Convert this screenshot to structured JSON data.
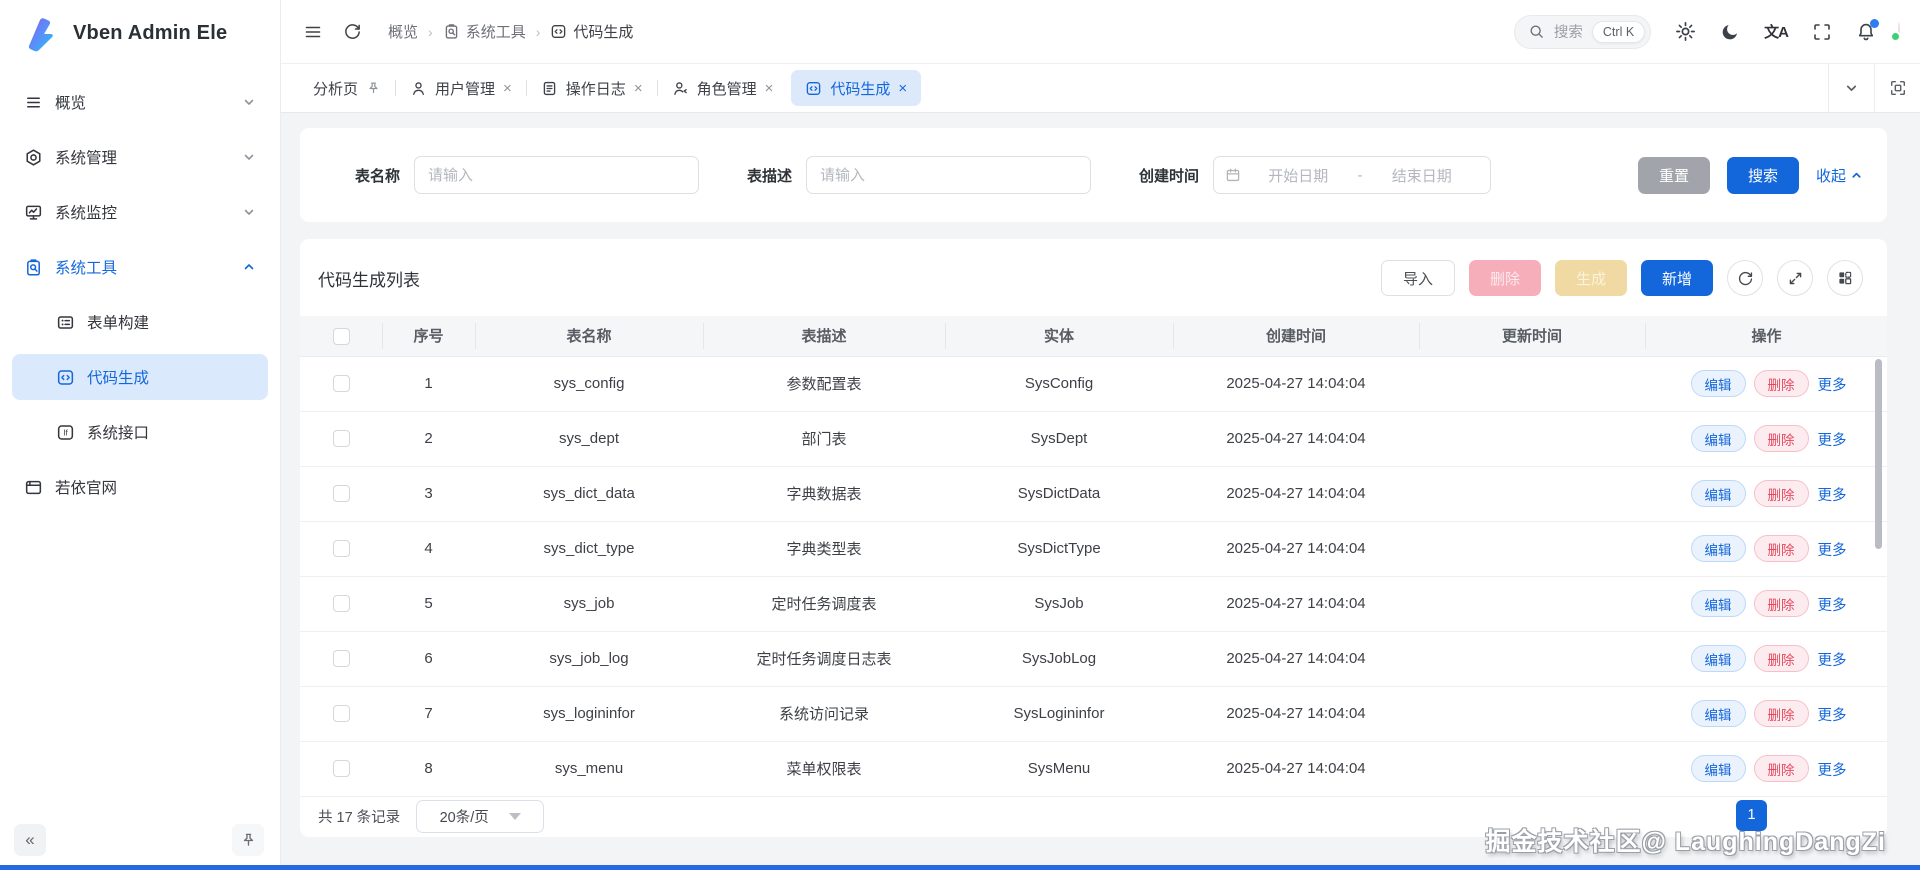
{
  "app": {
    "title": "Vben Admin Ele"
  },
  "header": {
    "breadcrumb": [
      {
        "label": "概览"
      },
      {
        "label": "系统工具"
      },
      {
        "label": "代码生成"
      }
    ],
    "search": {
      "placeholder": "搜索",
      "shortcut": "Ctrl K"
    },
    "translate_label": "文A"
  },
  "tabs": [
    {
      "label": "分析页"
    },
    {
      "label": "用户管理"
    },
    {
      "label": "操作日志"
    },
    {
      "label": "角色管理"
    },
    {
      "label": "代码生成"
    }
  ],
  "sidebar": {
    "items": [
      {
        "label": "概览"
      },
      {
        "label": "系统管理"
      },
      {
        "label": "系统监控"
      },
      {
        "label": "系统工具",
        "children": [
          {
            "label": "表单构建"
          },
          {
            "label": "代码生成"
          },
          {
            "label": "系统接口"
          }
        ]
      },
      {
        "label": "若依官网"
      }
    ]
  },
  "filter": {
    "table_name": {
      "label": "表名称",
      "placeholder": "请输入"
    },
    "table_desc": {
      "label": "表描述",
      "placeholder": "请输入"
    },
    "created": {
      "label": "创建时间",
      "start_placeholder": "开始日期",
      "separator": "-",
      "end_placeholder": "结束日期"
    },
    "reset_label": "重置",
    "search_label": "搜索",
    "collapse_label": "收起"
  },
  "table": {
    "title": "代码生成列表",
    "toolbar": {
      "import_label": "导入",
      "delete_label": "删除",
      "generate_label": "生成",
      "add_label": "新增"
    },
    "columns": [
      "序号",
      "表名称",
      "表描述",
      "实体",
      "创建时间",
      "更新时间",
      "操作"
    ],
    "actions": {
      "edit": "编辑",
      "delete": "删除",
      "more": "更多"
    },
    "rows": [
      {
        "seq": "1",
        "name": "sys_config",
        "desc": "参数配置表",
        "entity": "SysConfig",
        "created": "2025-04-27 14:04:04",
        "updated": ""
      },
      {
        "seq": "2",
        "name": "sys_dept",
        "desc": "部门表",
        "entity": "SysDept",
        "created": "2025-04-27 14:04:04",
        "updated": ""
      },
      {
        "seq": "3",
        "name": "sys_dict_data",
        "desc": "字典数据表",
        "entity": "SysDictData",
        "created": "2025-04-27 14:04:04",
        "updated": ""
      },
      {
        "seq": "4",
        "name": "sys_dict_type",
        "desc": "字典类型表",
        "entity": "SysDictType",
        "created": "2025-04-27 14:04:04",
        "updated": ""
      },
      {
        "seq": "5",
        "name": "sys_job",
        "desc": "定时任务调度表",
        "entity": "SysJob",
        "created": "2025-04-27 14:04:04",
        "updated": ""
      },
      {
        "seq": "6",
        "name": "sys_job_log",
        "desc": "定时任务调度日志表",
        "entity": "SysJobLog",
        "created": "2025-04-27 14:04:04",
        "updated": ""
      },
      {
        "seq": "7",
        "name": "sys_logininfor",
        "desc": "系统访问记录",
        "entity": "SysLogininfor",
        "created": "2025-04-27 14:04:04",
        "updated": ""
      },
      {
        "seq": "8",
        "name": "sys_menu",
        "desc": "菜单权限表",
        "entity": "SysMenu",
        "created": "2025-04-27 14:04:04",
        "updated": ""
      }
    ]
  },
  "pagination": {
    "total_text": "共 17 条记录",
    "page_size": "20条/页",
    "current_page": "1"
  },
  "watermark": "掘金技术社区@ LaughingDangZi",
  "colors": {
    "primary": "#1467db",
    "primary_light": "#dbe9fb",
    "danger": "#e5495e",
    "reset_gray": "#a1a5ab",
    "content_bg": "#f3f4f6"
  }
}
